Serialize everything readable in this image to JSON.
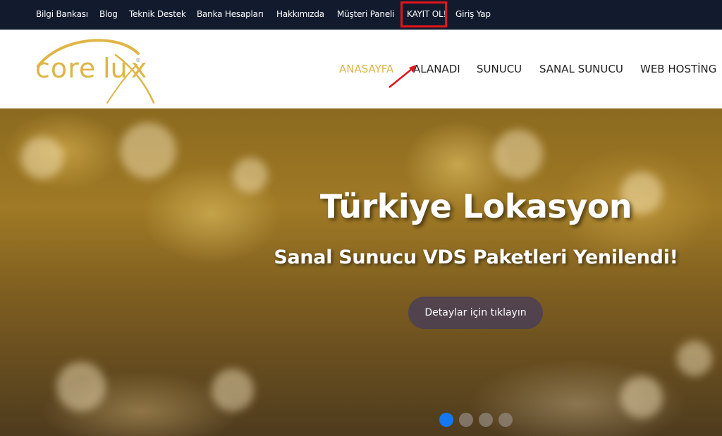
{
  "topbar": {
    "items": [
      {
        "label": "Bilgi Bankası"
      },
      {
        "label": "Blog"
      },
      {
        "label": "Teknik Destek"
      },
      {
        "label": "Banka Hesapları"
      },
      {
        "label": "Hakkımızda"
      },
      {
        "label": "Müşteri Paneli"
      },
      {
        "label": "KAYIT OL!"
      },
      {
        "label": "Giriş Yap"
      }
    ]
  },
  "header": {
    "logo": {
      "text_core": "core",
      "text_lu": "lu",
      "text_x": "x",
      "trademark": "®"
    },
    "nav": [
      {
        "label": "ANASAYFA",
        "active": true
      },
      {
        "label": "ALANADI"
      },
      {
        "label": "SUNUCU"
      },
      {
        "label": "SANAL SUNUCU"
      },
      {
        "label": "WEB HOSTİNG"
      }
    ]
  },
  "hero": {
    "title": "Türkiye Lokasyon",
    "subtitle": "Sanal Sunucu VDS Paketleri Yenilendi!",
    "button_label": "Detaylar için tıklayın",
    "slide_count": 4,
    "active_slide": 0
  },
  "colors": {
    "topbar_bg": "#121a2e",
    "brand_gold": "#e0b546",
    "highlight_red": "#e0161b",
    "active_dot": "#1479f0"
  }
}
